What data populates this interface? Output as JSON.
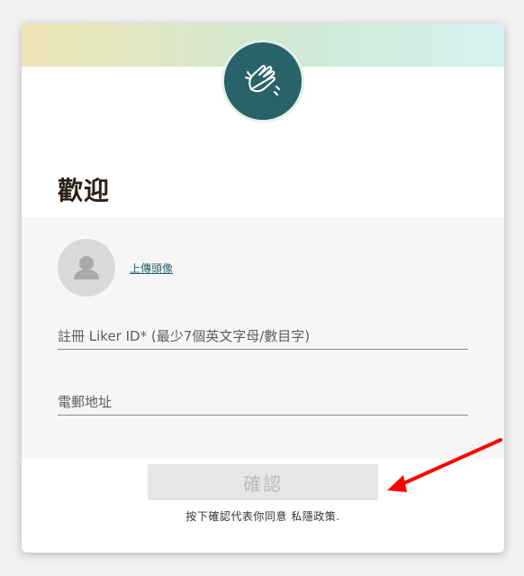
{
  "dialog": {
    "title": "歡迎",
    "upload_link": "上傳頭像",
    "liker_id_placeholder": "註冊 Liker ID* (最少7個英文字母/數目字)",
    "email_placeholder": "電郵地址",
    "confirm_label": "確認",
    "terms_prefix": "按下確認代表你同意 ",
    "privacy_link": "私隱政策",
    "terms_suffix": "."
  },
  "icons": {
    "logo": "clapping-hands-icon",
    "avatar": "user-placeholder-icon",
    "annotation": "red-arrow-icon"
  },
  "colors": {
    "brand": "#2a6269",
    "accent_link": "#2a6269",
    "button_disabled_bg": "#e6e6e6",
    "button_disabled_text": "#b9b9b9",
    "annotation_arrow": "#ff0000"
  }
}
